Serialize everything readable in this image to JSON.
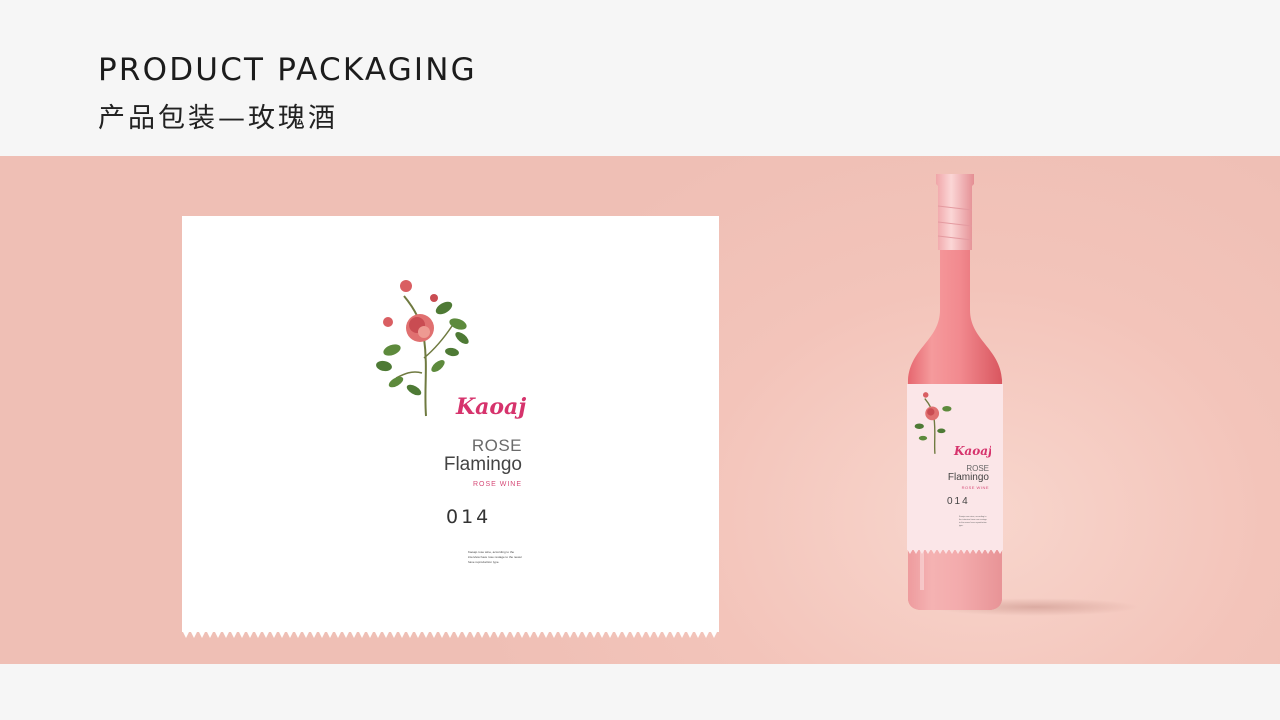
{
  "header": {
    "title_en": "PRODUCT PACKAGING",
    "title_cn": "产品包装—玫瑰酒"
  },
  "label": {
    "brand": "Kaoajo",
    "rose_text": "ROSE",
    "flamingo_text": "Flamingo",
    "wine_text": "ROSE WINE",
    "number": "014",
    "description": "Kaoajo rose wine, according to the interview have rose restage to the newer have reproduction type."
  },
  "bottle": {
    "brand": "Kaoajo",
    "rose_text": "ROSE",
    "flamingo_text": "Flamingo",
    "wine_text": "ROSE WINE",
    "number": "014"
  },
  "colors": {
    "background": "#f6f6f6",
    "band": "#f0c2b8",
    "label_bg": "#ffffff",
    "accent_pink": "#d6336c",
    "bottle_liquid": "#f2888b"
  }
}
